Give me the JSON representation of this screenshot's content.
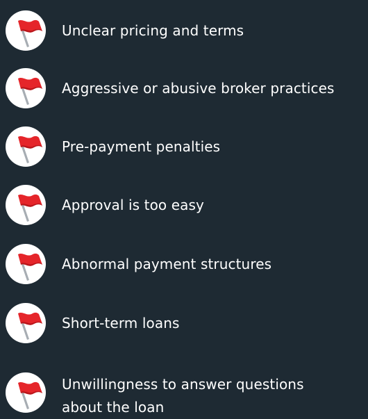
{
  "items": [
    {
      "label": "Unclear pricing and terms",
      "icon": "red-flag-icon"
    },
    {
      "label": "Aggressive or abusive broker practices",
      "icon": "red-flag-icon"
    },
    {
      "label": "Pre-payment penalties",
      "icon": "red-flag-icon"
    },
    {
      "label": "Approval is too easy",
      "icon": "red-flag-icon"
    },
    {
      "label": "Abnormal payment structures",
      "icon": "red-flag-icon"
    },
    {
      "label": "Short-term loans",
      "icon": "red-flag-icon"
    },
    {
      "label": "Unwillingness to answer questions",
      "label_line2": "about the loan",
      "icon": "red-flag-icon"
    }
  ],
  "colors": {
    "background": "#1e2a33",
    "text": "#ffffff",
    "flag": "#e5252a",
    "badge": "#ffffff",
    "pole": "#9aa0a6"
  }
}
